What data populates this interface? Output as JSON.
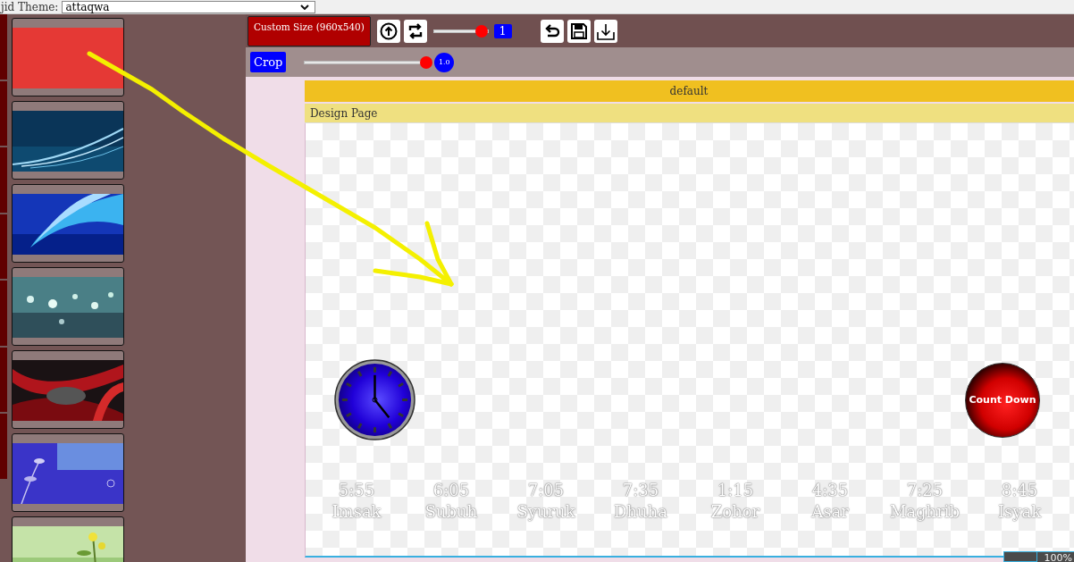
{
  "theme_bar": {
    "label": "jid Theme:",
    "value": "attaqwa"
  },
  "thumbnails": [
    {
      "kind": "swatch",
      "color": "#e53935"
    },
    {
      "kind": "picture"
    },
    {
      "kind": "picture"
    },
    {
      "kind": "picture"
    },
    {
      "kind": "picture"
    },
    {
      "kind": "picture"
    },
    {
      "kind": "picture"
    }
  ],
  "toolbar": {
    "size_button": "Custom Size (960x540)",
    "zoom_slider": {
      "level": 0.88,
      "reading": "1"
    },
    "crop_button": "Crop",
    "crop_slider": {
      "level": 0.97,
      "reading": "1.0"
    }
  },
  "layout_header": "default",
  "page_title": "Design Page",
  "canvas": {
    "countdown": "Count Down",
    "prayer_times": [
      {
        "time": "5:55",
        "name": "Imsak"
      },
      {
        "time": "6:05",
        "name": "Subuh"
      },
      {
        "time": "7:05",
        "name": "Syuruk"
      },
      {
        "time": "7:35",
        "name": "Dhuha"
      },
      {
        "time": "1:15",
        "name": "Zohor"
      },
      {
        "time": "4:35",
        "name": "Asar"
      },
      {
        "time": "7:25",
        "name": "Maghrib"
      },
      {
        "time": "8:45",
        "name": "Isyak"
      }
    ]
  },
  "zoom_indicator": "100%"
}
